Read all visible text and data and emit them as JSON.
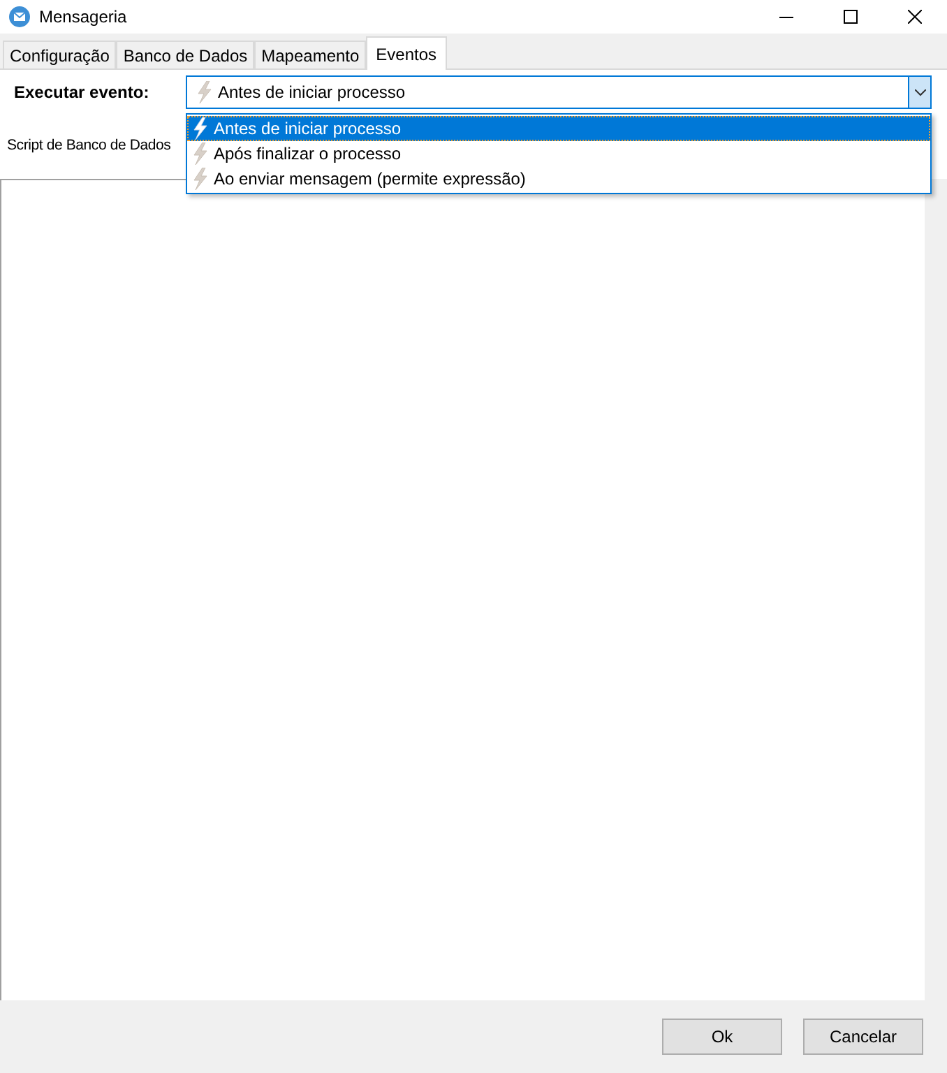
{
  "window": {
    "title": "Mensageria"
  },
  "tabs": [
    {
      "label": "Configuração",
      "selected": false
    },
    {
      "label": "Banco de Dados",
      "selected": false
    },
    {
      "label": "Mapeamento",
      "selected": false
    },
    {
      "label": "Eventos",
      "selected": true
    }
  ],
  "event_field": {
    "label": "Executar evento:",
    "value": "Antes de iniciar processo",
    "expanded": true
  },
  "event_options": [
    {
      "label": "Antes de iniciar processo",
      "selected": true
    },
    {
      "label": "Após finalizar o processo",
      "selected": false
    },
    {
      "label": "Ao enviar mensagem (permite expressão)",
      "selected": false
    }
  ],
  "script_label": "Script de Banco de Dados",
  "buttons": [
    "Ok",
    "Cancelar"
  ]
}
